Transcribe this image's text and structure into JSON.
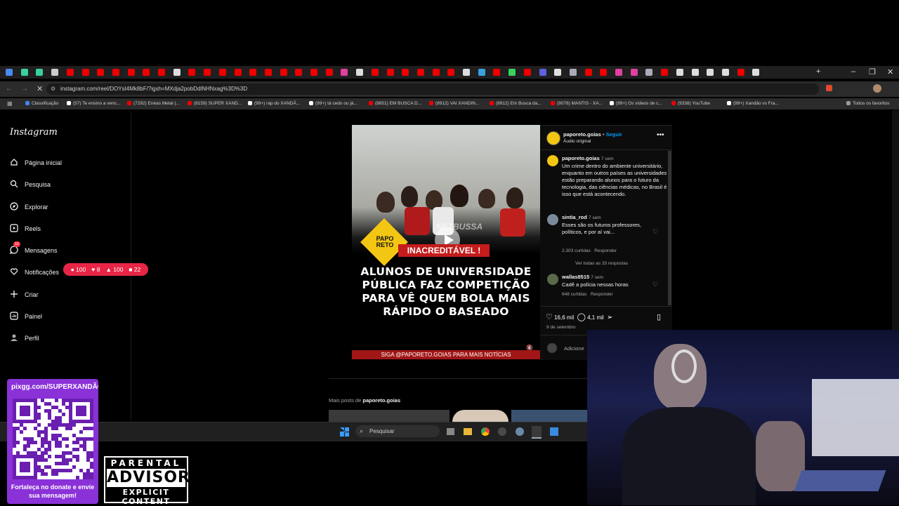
{
  "browser": {
    "url": "instagram.com/reel/DOYsI4Mk8bF/?igsh=MXdja2pobDdlNHNxag%3D%3D",
    "bookmarks": [
      {
        "label": "Classificação",
        "color": "#4285f4"
      },
      {
        "label": "(57) Te ensino a venc...",
        "color": "#ffffff"
      },
      {
        "label": "(7292) Enéas Metal |...",
        "color": "#e00"
      },
      {
        "label": "(8159) SUPER XAND...",
        "color": "#e00"
      },
      {
        "label": "(99+) rap do XANDÃ...",
        "color": "#ffffff"
      },
      {
        "label": "(99+) tá cedo ou já...",
        "color": "#ffffff"
      },
      {
        "label": "(8851) EM BUSCA D...",
        "color": "#e00"
      },
      {
        "label": "(8912) VAI XANDIN...",
        "color": "#e00"
      },
      {
        "label": "(8912) Em Busca da...",
        "color": "#e00"
      },
      {
        "label": "(9078) MANTIS - XA...",
        "color": "#e00"
      },
      {
        "label": "(99+) Os vídeos de c...",
        "color": "#ffffff"
      },
      {
        "label": "(9338) YouTube",
        "color": "#e00"
      },
      {
        "label": "(99+) Xandão vs Fra...",
        "color": "#ffffff"
      }
    ],
    "all_favorites": "Todos os favoritos"
  },
  "sidebar": {
    "logo": "Instagram",
    "items": [
      {
        "label": "Página inicial",
        "icon": "home-icon"
      },
      {
        "label": "Pesquisa",
        "icon": "search-icon"
      },
      {
        "label": "Explorar",
        "icon": "compass-icon"
      },
      {
        "label": "Reels",
        "icon": "reels-icon"
      },
      {
        "label": "Mensagens",
        "icon": "messenger-icon",
        "badge": "10"
      },
      {
        "label": "Notificações",
        "icon": "heart-icon"
      },
      {
        "label": "Criar",
        "icon": "plus-icon"
      },
      {
        "label": "Painel",
        "icon": "chart-icon"
      },
      {
        "label": "Perfil",
        "icon": "profile-icon"
      }
    ]
  },
  "notification_bubble": {
    "comments": "100",
    "likes": "8",
    "follows": "100",
    "tags": "22"
  },
  "reel": {
    "badge": "INACREDITÁVEL !",
    "logo_text": "PAPO RETO",
    "watermark": "NETBUSSA",
    "headline": "ALUNOS DE UNIVERSIDADE PÚBLICA FAZ COMPETIÇÃO PARA VÊ QUEM BOLA MAIS RÁPIDO O BASEADO",
    "footer": "SIGA @PAPORETO.GOIAS PARA MAIS NOTÍCIAS"
  },
  "post": {
    "author": "paporeto.goias",
    "follow": "Seguir",
    "audio": "Áudio original",
    "caption_time": "7 sem",
    "caption": "Um crime dentro do ambiente universitário, enquanto em outros países as universidades estão preparando alunos para o futuro da tecnologia, das ciências médicas, no Brasil é isso que está acontecendo.",
    "comments": [
      {
        "user": "sintia_rod",
        "time": "7 sem",
        "text": "Esses são os futuros professores, políticos, e por aí vai...",
        "likes": "2.303 curtidas",
        "reply": "Responder",
        "view_replies": "Ver todas as 33 respostas"
      },
      {
        "user": "wallas8515",
        "time": "7 sem",
        "text": "Cadê a polícia nessas horas",
        "likes": "648 curtidas",
        "reply": "Responder"
      }
    ],
    "like_count": "16,6 mil",
    "comment_count": "4,1 mil",
    "date": "9 de setembro",
    "add_comment": "Adicione"
  },
  "more_posts": {
    "prefix": "Mais posts de",
    "user": "paporeto.goias"
  },
  "taskbar": {
    "search": "Pesquisar"
  },
  "overlay": {
    "qr_title": "pixgg.com/SUPERXANDÃO",
    "qr_text": "Fortaleça no donate e envie sua mensagem!",
    "advisory_top": "PARENTAL",
    "advisory_mid": "ADVISORY",
    "advisory_bottom": "EXPLICIT CONTENT"
  }
}
